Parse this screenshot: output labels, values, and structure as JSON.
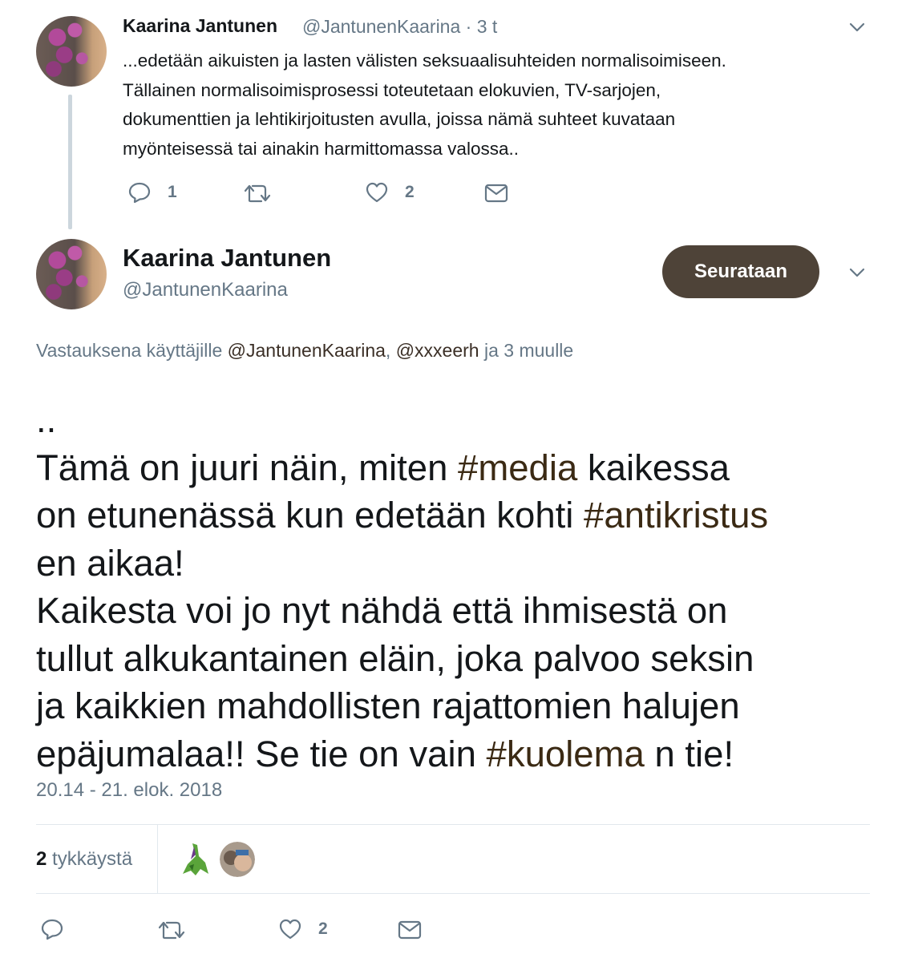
{
  "reply_tweet": {
    "author_name": "Kaarina Jantunen",
    "author_handle": "@JantunenKaarina",
    "time": "· 3 t",
    "lines": [
      "...edetään aikuisten ja lasten välisten seksuaalisuhteiden normalisoimiseen.",
      "Tällainen normalisoimisprosessi toteutetaan elokuvien, TV-sarjojen,",
      "dokumenttien ja lehtikirjoitusten avulla, joissa nämä suhteet kuvataan",
      "myönteisessä tai ainakin harmittomassa valossa.."
    ],
    "reply_count": "1",
    "like_count": "2"
  },
  "main_tweet": {
    "author_name": "Kaarina Jantunen",
    "author_handle": "@JantunenKaarina",
    "follow_label": "Seurataan",
    "replying_prefix": "Vastauksena käyttäjille",
    "replying_mention_1": "@JantunenKaarina",
    "replying_comma": ",",
    "replying_mention_2": "@xxxeerh",
    "replying_suffix": "ja 3 muulle",
    "text": {
      "l1": "..",
      "l2a": "Tämä on juuri näin, miten ",
      "tag_media": "#media",
      "l2b": " kaikessa",
      "l3a": "on etunenässä kun edetään kohti ",
      "tag_antikristus": "#antikristus",
      "l4": "en aikaa!",
      "l5": "Kaikesta voi jo nyt nähdä että ihmisestä on",
      "l6": "tullut alkukantainen eläin, joka palvoo seksin",
      "l7": "ja kaikkien mahdollisten rajattomien halujen",
      "l8a": "epäjumalaa!! Se tie on vain ",
      "tag_kuolema": "#kuolema",
      "l8b": " n tie!"
    },
    "timestamp": "20.14 - 21. elok. 2018",
    "likes_count": "2",
    "likes_label": " tykkäystä",
    "bottom_like_count": "2"
  },
  "colors": {
    "follow_button_bg": "#4e4338",
    "hashtag": "#3b2a14",
    "secondary_text": "#657786",
    "divider": "#e1e8ed"
  },
  "icons": [
    "chevron-down-icon",
    "reply-icon",
    "retweet-icon",
    "heart-icon",
    "dm-envelope-icon"
  ]
}
